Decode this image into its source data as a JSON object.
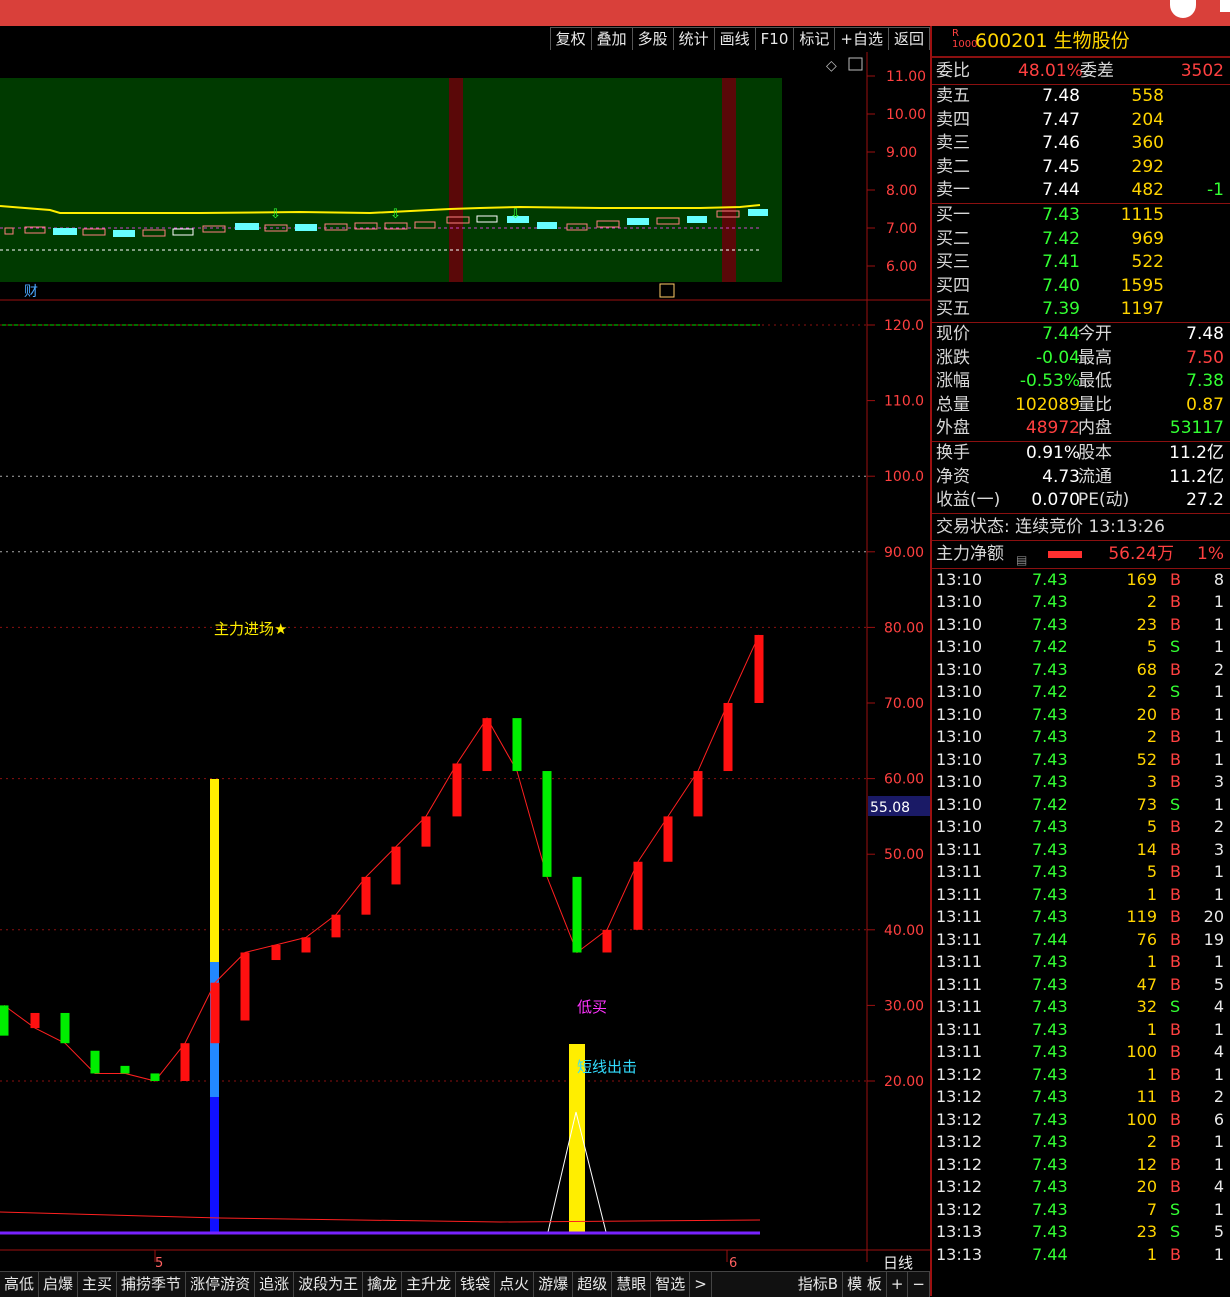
{
  "toolbar": [
    "复权",
    "叠加",
    "多股",
    "统计",
    "画线",
    "F10",
    "标记",
    "+自选",
    "返回"
  ],
  "price_axis": [
    "11.00",
    "10.00",
    "9.00",
    "8.00",
    "7.00",
    "6.00"
  ],
  "indicator_axis": [
    "120.0",
    "110.0",
    "100.0",
    "90.00",
    "80.00",
    "70.00",
    "60.00",
    "50.00",
    "40.00",
    "30.00",
    "20.00"
  ],
  "cursor_value": "55.08",
  "labels": {
    "main_force": "主力进场★",
    "low_buy": "低买",
    "short_attack": "短线出击",
    "cai": "财",
    "x5": "5",
    "x6": "6",
    "daily": "日线"
  },
  "stock": {
    "r_mark": "R",
    "r_num": "1000",
    "code": "600201",
    "name": "生物股份"
  },
  "weibi": {
    "label": "委比",
    "value": "48.01%",
    "label2": "委差",
    "value2": "3502"
  },
  "sells": [
    {
      "label": "卖五",
      "price": "7.48",
      "vol": "558",
      "chg": ""
    },
    {
      "label": "卖四",
      "price": "7.47",
      "vol": "204",
      "chg": ""
    },
    {
      "label": "卖三",
      "price": "7.46",
      "vol": "360",
      "chg": ""
    },
    {
      "label": "卖二",
      "price": "7.45",
      "vol": "292",
      "chg": ""
    },
    {
      "label": "卖一",
      "price": "7.44",
      "vol": "482",
      "chg": "-1"
    }
  ],
  "buys": [
    {
      "label": "买一",
      "price": "7.43",
      "vol": "1115"
    },
    {
      "label": "买二",
      "price": "7.42",
      "vol": "969"
    },
    {
      "label": "买三",
      "price": "7.41",
      "vol": "522"
    },
    {
      "label": "买四",
      "price": "7.40",
      "vol": "1595"
    },
    {
      "label": "买五",
      "price": "7.39",
      "vol": "1197"
    }
  ],
  "quote": [
    {
      "l1": "现价",
      "v1": "7.44",
      "c1": "green",
      "l2": "今开",
      "v2": "7.48",
      "c2": "white"
    },
    {
      "l1": "涨跌",
      "v1": "-0.04",
      "c1": "green",
      "l2": "最高",
      "v2": "7.50",
      "c2": "red"
    },
    {
      "l1": "涨幅",
      "v1": "-0.53%",
      "c1": "green",
      "l2": "最低",
      "v2": "7.38",
      "c2": "green"
    },
    {
      "l1": "总量",
      "v1": "102089",
      "c1": "yellow",
      "l2": "量比",
      "v2": "0.87",
      "c2": "yellow"
    },
    {
      "l1": "外盘",
      "v1": "48972",
      "c1": "red",
      "l2": "内盘",
      "v2": "53117",
      "c2": "green"
    }
  ],
  "fund": [
    {
      "l1": "换手",
      "v1": "0.91%",
      "l2": "股本",
      "v2": "11.2亿"
    },
    {
      "l1": "净资",
      "v1": "4.73",
      "l2": "流通",
      "v2": "11.2亿"
    },
    {
      "l1": "收益(一)",
      "v1": "0.070",
      "l2": "PE(动)",
      "v2": "27.2"
    }
  ],
  "trade_status": "交易状态: 连续竞价 13:13:26",
  "main_net": {
    "label": "主力净额",
    "value": "56.24万",
    "pct": "1%"
  },
  "ticks": [
    {
      "t": "13:10",
      "p": "7.43",
      "q": "169",
      "s": "B",
      "n": "8"
    },
    {
      "t": "13:10",
      "p": "7.43",
      "q": "2",
      "s": "B",
      "n": "1"
    },
    {
      "t": "13:10",
      "p": "7.43",
      "q": "23",
      "s": "B",
      "n": "1"
    },
    {
      "t": "13:10",
      "p": "7.42",
      "q": "5",
      "s": "S",
      "n": "1"
    },
    {
      "t": "13:10",
      "p": "7.43",
      "q": "68",
      "s": "B",
      "n": "2"
    },
    {
      "t": "13:10",
      "p": "7.42",
      "q": "2",
      "s": "S",
      "n": "1"
    },
    {
      "t": "13:10",
      "p": "7.43",
      "q": "20",
      "s": "B",
      "n": "1"
    },
    {
      "t": "13:10",
      "p": "7.43",
      "q": "2",
      "s": "B",
      "n": "1"
    },
    {
      "t": "13:10",
      "p": "7.43",
      "q": "52",
      "s": "B",
      "n": "1"
    },
    {
      "t": "13:10",
      "p": "7.43",
      "q": "3",
      "s": "B",
      "n": "3"
    },
    {
      "t": "13:10",
      "p": "7.42",
      "q": "73",
      "s": "S",
      "n": "1"
    },
    {
      "t": "13:10",
      "p": "7.43",
      "q": "5",
      "s": "B",
      "n": "2"
    },
    {
      "t": "13:11",
      "p": "7.43",
      "q": "14",
      "s": "B",
      "n": "3"
    },
    {
      "t": "13:11",
      "p": "7.43",
      "q": "5",
      "s": "B",
      "n": "1"
    },
    {
      "t": "13:11",
      "p": "7.43",
      "q": "1",
      "s": "B",
      "n": "1"
    },
    {
      "t": "13:11",
      "p": "7.43",
      "q": "119",
      "s": "B",
      "n": "20"
    },
    {
      "t": "13:11",
      "p": "7.44",
      "q": "76",
      "s": "B",
      "n": "19"
    },
    {
      "t": "13:11",
      "p": "7.43",
      "q": "1",
      "s": "B",
      "n": "1"
    },
    {
      "t": "13:11",
      "p": "7.43",
      "q": "47",
      "s": "B",
      "n": "5"
    },
    {
      "t": "13:11",
      "p": "7.43",
      "q": "32",
      "s": "S",
      "n": "4"
    },
    {
      "t": "13:11",
      "p": "7.43",
      "q": "1",
      "s": "B",
      "n": "1"
    },
    {
      "t": "13:11",
      "p": "7.43",
      "q": "100",
      "s": "B",
      "n": "4"
    },
    {
      "t": "13:12",
      "p": "7.43",
      "q": "1",
      "s": "B",
      "n": "1"
    },
    {
      "t": "13:12",
      "p": "7.43",
      "q": "11",
      "s": "B",
      "n": "2"
    },
    {
      "t": "13:12",
      "p": "7.43",
      "q": "100",
      "s": "B",
      "n": "6"
    },
    {
      "t": "13:12",
      "p": "7.43",
      "q": "2",
      "s": "B",
      "n": "1"
    },
    {
      "t": "13:12",
      "p": "7.43",
      "q": "12",
      "s": "B",
      "n": "1"
    },
    {
      "t": "13:12",
      "p": "7.43",
      "q": "20",
      "s": "B",
      "n": "4"
    },
    {
      "t": "13:12",
      "p": "7.43",
      "q": "7",
      "s": "S",
      "n": "1"
    },
    {
      "t": "13:13",
      "p": "7.43",
      "q": "23",
      "s": "S",
      "n": "5"
    },
    {
      "t": "13:13",
      "p": "7.44",
      "q": "1",
      "s": "B",
      "n": "1"
    }
  ],
  "bottom_tabs": [
    "高低",
    "启爆",
    "主买",
    "捕捞季节",
    "涨停游资",
    "追涨",
    "波段为王",
    "擒龙",
    "主升龙",
    "钱袋",
    "点火",
    "游爆",
    "超级",
    "慧眼",
    "智选",
    ">",
    "指标B",
    "模 板",
    "+",
    "−"
  ],
  "colors": {
    "up": "#ff1010",
    "down": "#00ee00",
    "bg_panel": "#003a00",
    "accent": "#d9403a"
  },
  "chart_data": {
    "type": "bar",
    "indicator_bars": [
      {
        "open": 26,
        "close": 30,
        "color": "green"
      },
      {
        "open": 29,
        "close": 27,
        "color": "red"
      },
      {
        "open": 29,
        "close": 25,
        "color": "green"
      },
      {
        "open": 24,
        "close": 21,
        "color": "green"
      },
      {
        "open": 22,
        "close": 21,
        "color": "green"
      },
      {
        "open": 21,
        "close": 20,
        "color": "green"
      },
      {
        "open": 20,
        "close": 25,
        "color": "red"
      },
      {
        "open": 25,
        "close": 33,
        "color": "red"
      },
      {
        "open": 28,
        "close": 37,
        "color": "red"
      },
      {
        "open": 36,
        "close": 38,
        "color": "red"
      },
      {
        "open": 37,
        "close": 39,
        "color": "red"
      },
      {
        "open": 39,
        "close": 42,
        "color": "red"
      },
      {
        "open": 42,
        "close": 47,
        "color": "red"
      },
      {
        "open": 46,
        "close": 51,
        "color": "red"
      },
      {
        "open": 51,
        "close": 55,
        "color": "red"
      },
      {
        "open": 55,
        "close": 62,
        "color": "red"
      },
      {
        "open": 61,
        "close": 68,
        "color": "red"
      },
      {
        "open": 68,
        "close": 61,
        "color": "green"
      },
      {
        "open": 61,
        "close": 47,
        "color": "green"
      },
      {
        "open": 47,
        "close": 37,
        "color": "green"
      },
      {
        "open": 37,
        "close": 40,
        "color": "red"
      },
      {
        "open": 40,
        "close": 49,
        "color": "red"
      },
      {
        "open": 49,
        "close": 55,
        "color": "red"
      },
      {
        "open": 55,
        "close": 61,
        "color": "red"
      },
      {
        "open": 61,
        "close": 70,
        "color": "red"
      },
      {
        "open": 70,
        "close": 79,
        "color": "red"
      }
    ],
    "ylim": [
      20,
      120
    ]
  }
}
